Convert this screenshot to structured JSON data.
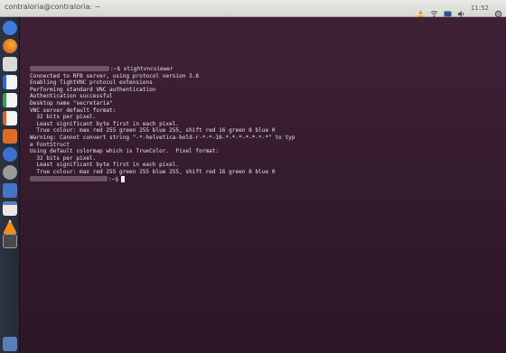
{
  "topbar": {
    "title": "contraloria@contraloria: ~",
    "time": "11:52",
    "tray_icons": [
      "vlc-icon",
      "network-icon",
      "keyboard-icon",
      "volume-icon",
      "clock-text",
      "gear-icon"
    ]
  },
  "launcher": {
    "icons": [
      {
        "name": "search-icon",
        "color": "#3b7bd9"
      },
      {
        "name": "firefox-icon",
        "color": "#e96a2a"
      },
      {
        "name": "files-icon",
        "color": "#d9d9d9"
      },
      {
        "name": "writer-icon",
        "color": "#2e6ad1"
      },
      {
        "name": "calc-icon",
        "color": "#3ea04c"
      },
      {
        "name": "impress-icon",
        "color": "#d5672b"
      },
      {
        "name": "software-center-icon",
        "color": "#e06b24"
      },
      {
        "name": "help-icon",
        "color": "#3d6fcf"
      },
      {
        "name": "settings-icon",
        "color": "#9a9a9a"
      },
      {
        "name": "thunderbird-icon",
        "color": "#4773c9"
      },
      {
        "name": "text-editor-icon",
        "color": "#5b7dbf"
      },
      {
        "name": "vlc-icon",
        "color": "#f08c1d"
      },
      {
        "name": "terminal-icon",
        "color": "#5a5a5a"
      },
      {
        "name": "trash-icon",
        "color": "#5a7fb7"
      }
    ]
  },
  "terminal": {
    "line0_prompt_suffix": ":~$ xtightvncviewer",
    "lines": [
      "Connected to RFB server, using protocol version 3.8",
      "Enabling TightVNC protocol extensions",
      "Performing standard VNC authentication",
      "Authentication successful",
      "Desktop name \"secretaria\"",
      "VNC server default format:",
      "  32 bits per pixel.",
      "  Least significant byte first in each pixel.",
      "  True colour: max red 255 green 255 blue 255, shift red 16 green 8 blue 0",
      "Warning: Cannot convert string \"-*-helvetica-bold-r-*-*-16-*-*-*-*-*-*-*\" to typ",
      "e FontStruct",
      "Using default colormap which is TrueColor.  Pixel format:",
      "  32 bits per pixel.",
      "  Least significant byte first in each pixel.",
      "  True colour: max red 255 green 255 blue 255, shift red 16 green 8 blue 0"
    ],
    "last_prompt_suffix": ":~$"
  }
}
